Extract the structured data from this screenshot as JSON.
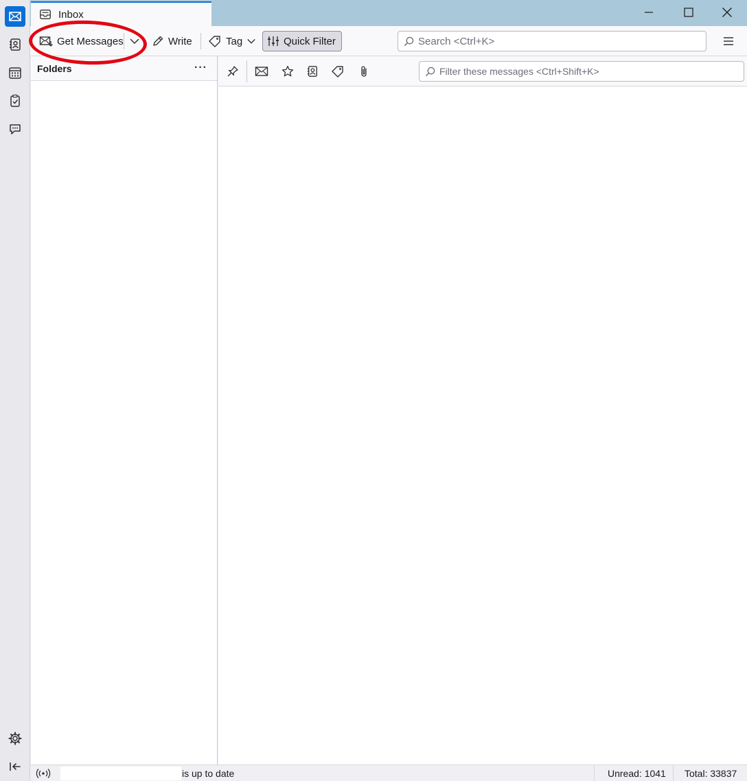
{
  "tab": {
    "title": "Inbox"
  },
  "toolbar": {
    "get_messages_label": "Get Messages",
    "write_label": "Write",
    "tag_label": "Tag",
    "quick_filter_label": "Quick Filter",
    "search_placeholder": "Search <Ctrl+K>"
  },
  "folder_pane": {
    "header": "Folders",
    "more": "···"
  },
  "quick_filter": {
    "placeholder": "Filter these messages <Ctrl+Shift+K>"
  },
  "status": {
    "message": "is up to date",
    "unread": "Unread: 1041",
    "total": "Total: 33837"
  },
  "colors": {
    "accent": "#0a6fd4",
    "highlight": "#e30613",
    "titlebar": "#a9c9da"
  },
  "icons": {
    "spaces": [
      "mail-icon",
      "address-book-icon",
      "calendar-icon",
      "tasks-icon",
      "chat-icon",
      "settings-icon",
      "collapse-icon"
    ]
  }
}
